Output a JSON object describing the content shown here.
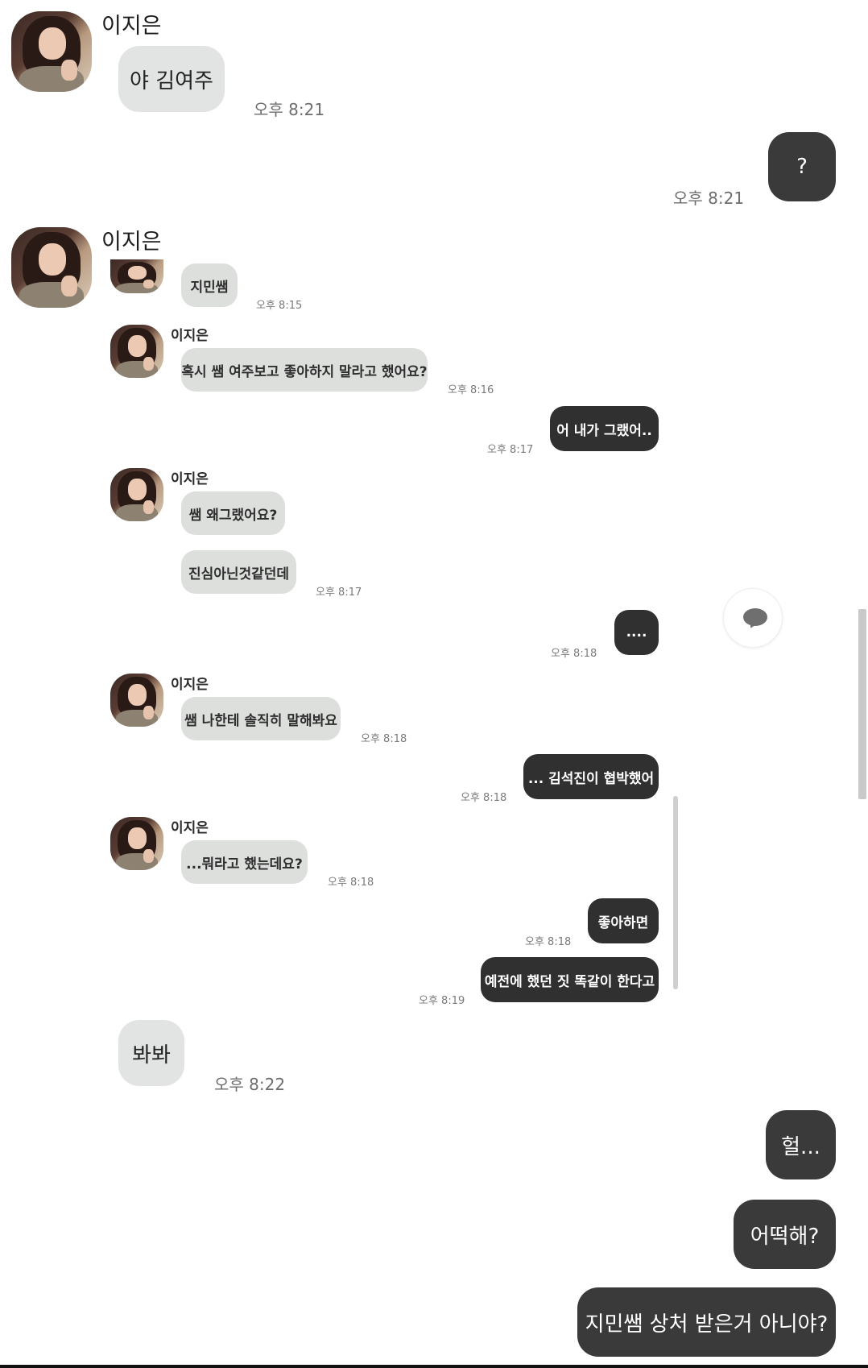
{
  "outer": {
    "sender_name_1": "이지은",
    "sender_name_2": "이지은",
    "messages": [
      {
        "text": "야 김여주",
        "time": "오후 8:21"
      },
      {
        "text": "?",
        "time": "오후 8:21"
      },
      {
        "text": "봐봐",
        "time": "오후 8:22"
      },
      {
        "text": "헐..."
      },
      {
        "text": "어떡해?"
      },
      {
        "text": "지민쌤 상처 받은거 아니야?"
      }
    ]
  },
  "screenshot": {
    "names": [
      "이지은",
      "이지은",
      "이지은",
      "이지은"
    ],
    "messages": [
      {
        "text": "지민쌤",
        "time": "오후 8:15"
      },
      {
        "text": "혹시 쌤 여주보고 좋아하지 말라고 했어요?",
        "time": "오후 8:16"
      },
      {
        "text": "어 내가 그랬어..",
        "time": "오후 8:17"
      },
      {
        "text": "쌤 왜그랬어요?"
      },
      {
        "text": "진심아닌것같던데",
        "time": "오후 8:17"
      },
      {
        "text": "....",
        "time": "오후 8:18"
      },
      {
        "text": "쌤 나한테 솔직히 말해봐요",
        "time": "오후 8:18"
      },
      {
        "text": "... 김석진이 협박했어",
        "time": "오후 8:18"
      },
      {
        "text": "...뭐라고 했는데요?",
        "time": "오후 8:18"
      },
      {
        "text": "좋아하면",
        "time": "오후 8:18"
      },
      {
        "text": "예전에 했던 짓 똑같이 한다고",
        "time": "오후 8:19"
      }
    ]
  },
  "icons": {
    "chat_button": "speech-bubble-icon"
  }
}
